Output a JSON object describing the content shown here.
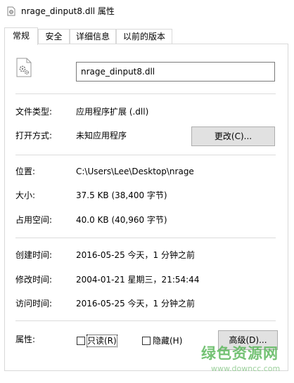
{
  "window": {
    "title": "nrage_dinput8.dll 属性",
    "icon": "settings-gear-file-icon"
  },
  "tabs": [
    {
      "label": "常规",
      "active": true
    },
    {
      "label": "安全",
      "active": false
    },
    {
      "label": "详细信息",
      "active": false
    },
    {
      "label": "以前的版本",
      "active": false
    }
  ],
  "general": {
    "file_icon": "dll-file-icon",
    "file_name": "nrage_dinput8.dll",
    "file_type_label": "文件类型:",
    "file_type_value": "应用程序扩展 (.dll)",
    "opens_with_label": "打开方式:",
    "opens_with_value": "未知应用程序",
    "change_button": "更改(C)...",
    "location_label": "位置:",
    "location_value": "C:\\Users\\Lee\\Desktop\\nrage",
    "size_label": "大小:",
    "size_value": "37.5 KB (38,400 字节)",
    "size_on_disk_label": "占用空间:",
    "size_on_disk_value": "40.0 KB (40,960 字节)",
    "created_label": "创建时间:",
    "created_value": "2016-05-25 今天，1 分钟之前",
    "modified_label": "修改时间:",
    "modified_value": "2004-01-21 星期三，21:54:44",
    "accessed_label": "访问时间:",
    "accessed_value": "2016-05-25 今天，1 分钟之前",
    "attributes_label": "属性:",
    "readonly_label": "只读(R)",
    "readonly_checked": false,
    "hidden_label": "隐藏(H)",
    "hidden_checked": false,
    "advanced_button": "高级(D)..."
  },
  "watermark": {
    "main": "绿色资源网",
    "sub": "www.downcc.com"
  },
  "colors": {
    "border": "#d9d9d9",
    "button_bg": "#e1e1e1",
    "button_border": "#adadad",
    "watermark": "#5cb85c"
  }
}
